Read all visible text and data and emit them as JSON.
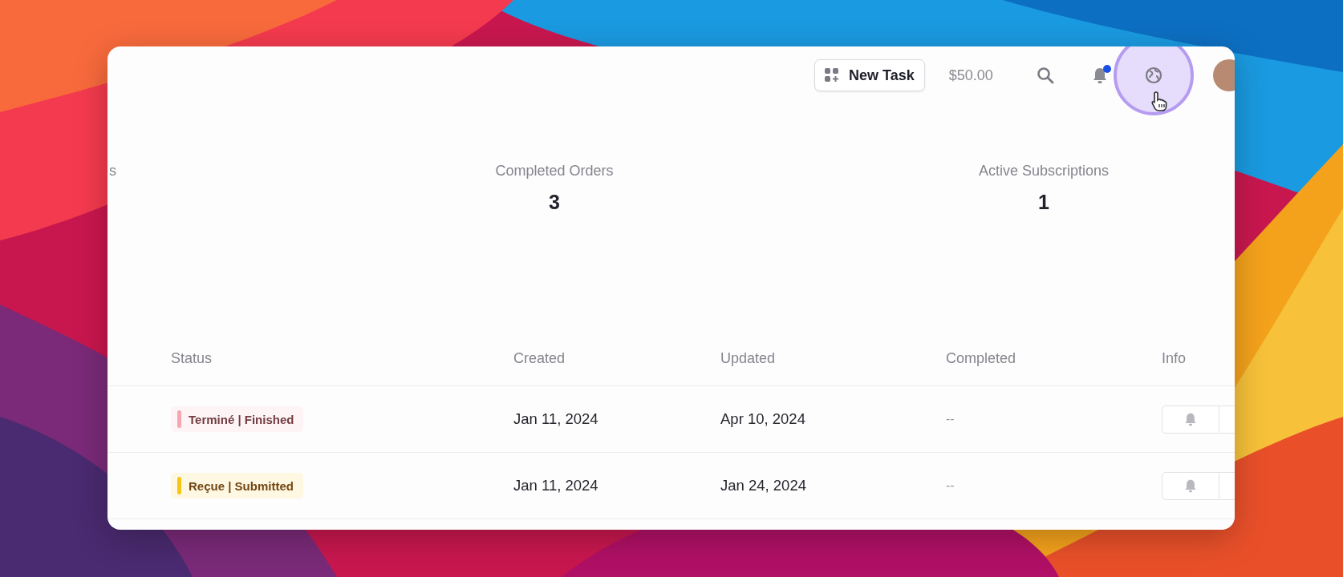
{
  "toolbar": {
    "new_task_button": "New Task",
    "balance": "$50.00",
    "notifications": {
      "unread": true
    },
    "globe_button": {
      "highlighted": true
    }
  },
  "stats": [
    {
      "label": "s"
    },
    {
      "label": "Completed Orders",
      "value": "3"
    },
    {
      "label": "Active Subscriptions",
      "value": "1"
    }
  ],
  "table": {
    "columns": [
      "Status",
      "Created",
      "Updated",
      "Completed",
      "Info"
    ],
    "rows": [
      {
        "status": "Terminé | Finished",
        "color": "#f4a7b0",
        "created": "Jan 11, 2024",
        "updated": "Apr 10, 2024",
        "completed": "--"
      },
      {
        "status": "Reçue | Submitted",
        "color": "#f5c518",
        "created": "Jan 11, 2024",
        "updated": "Jan 24, 2024",
        "completed": "--"
      }
    ]
  }
}
